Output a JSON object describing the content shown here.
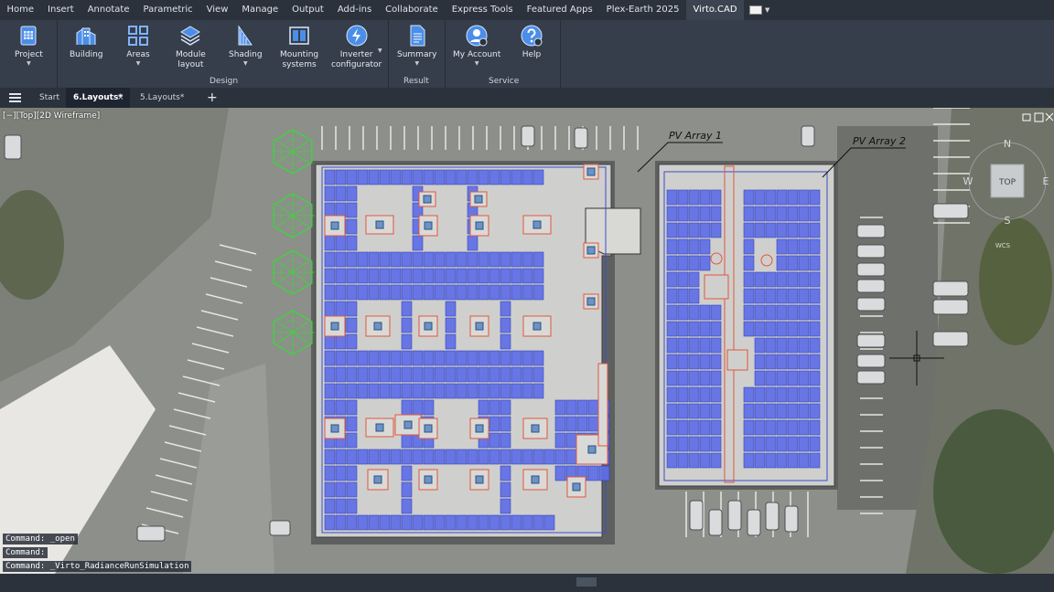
{
  "menu": [
    {
      "label": "Home"
    },
    {
      "label": "Insert"
    },
    {
      "label": "Annotate"
    },
    {
      "label": "Parametric"
    },
    {
      "label": "View"
    },
    {
      "label": "Manage"
    },
    {
      "label": "Output"
    },
    {
      "label": "Add-ins"
    },
    {
      "label": "Collaborate"
    },
    {
      "label": "Express Tools"
    },
    {
      "label": "Featured Apps"
    },
    {
      "label": "Plex-Earth 2025"
    },
    {
      "label": "Virto.CAD",
      "active": true
    }
  ],
  "ribbon": {
    "project": {
      "label": "Project"
    },
    "building": {
      "label": "Building"
    },
    "areas": {
      "label": "Areas"
    },
    "module_layout": {
      "line1": "Module",
      "line2": "layout"
    },
    "shading": {
      "label": "Shading"
    },
    "mounting": {
      "line1": "Mounting",
      "line2": "systems"
    },
    "inverter": {
      "line1": "Inverter",
      "line2": "configurator"
    },
    "summary": {
      "label": "Summary"
    },
    "account": {
      "label": "My Account"
    },
    "help": {
      "label": "Help"
    },
    "groups": {
      "design": "Design",
      "result": "Result",
      "service": "Service"
    }
  },
  "tabs": {
    "start": "Start",
    "layouts6": "6.Layouts*",
    "layouts5": "5.Layouts*",
    "close": "×",
    "add": "+"
  },
  "viewport": {
    "label": "[−][Top][2D Wireframe]",
    "array1": "PV Array 1",
    "array2": "PV Array 2",
    "compass": {
      "n": "N",
      "s": "S",
      "w": "W",
      "e": "E",
      "top": "TOP",
      "wcs": "WCS"
    }
  },
  "commands": [
    "Command: _open",
    "Command:",
    "Command: _Virto_RadianceRunSimulation"
  ],
  "colors": {
    "panel_fill": "#5f6fe6",
    "panel_stroke": "#2a38b8",
    "roof": "#cfd0cd",
    "keepout": "#e2563d",
    "tree": "#3fd43f"
  }
}
